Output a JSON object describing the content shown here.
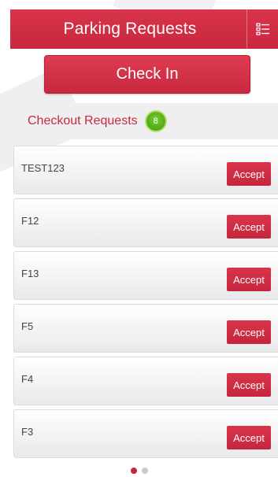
{
  "header": {
    "title": "Parking Requests",
    "menu_icon": "list-menu-icon"
  },
  "checkin": {
    "label": "Check In"
  },
  "section": {
    "title": "Checkout Requests",
    "count": "8"
  },
  "requests": [
    {
      "label": "TEST123",
      "action": "Accept"
    },
    {
      "label": "F12",
      "action": "Accept"
    },
    {
      "label": "F13",
      "action": "Accept"
    },
    {
      "label": "F5",
      "action": "Accept"
    },
    {
      "label": "F4",
      "action": "Accept"
    },
    {
      "label": "F3",
      "action": "Accept"
    }
  ],
  "pager": {
    "pages": 2,
    "active": 1
  },
  "colors": {
    "accent": "#c8283f",
    "badge": "#4ea31a",
    "section_bg": "#efeff1"
  }
}
